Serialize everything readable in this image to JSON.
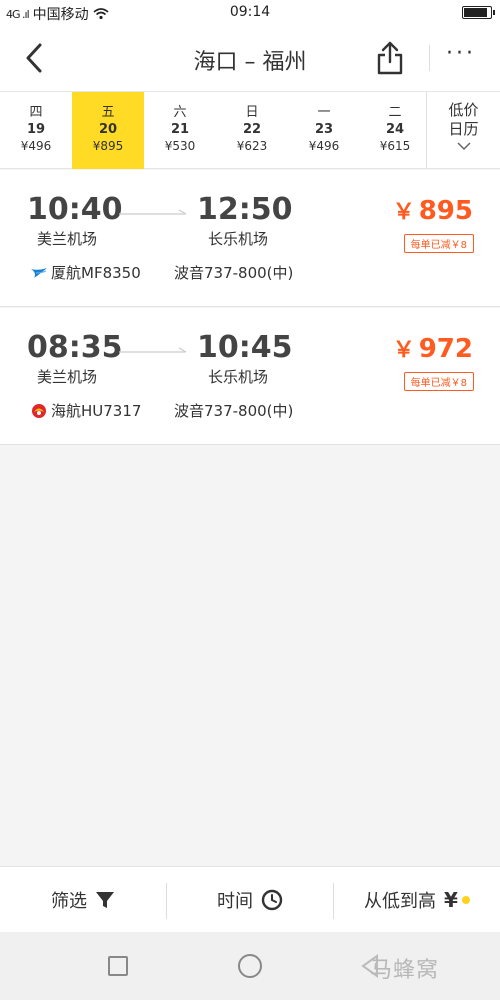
{
  "status_bar": {
    "signal": "4G .ıl",
    "carrier": "中国移动",
    "time": "09:14",
    "battery_level": 0.9
  },
  "header": {
    "title": "海口 – 福州",
    "back_icon": "chevron-left-icon",
    "share_icon": "share-icon",
    "more_icon": "more-icon",
    "more_label": "···"
  },
  "dates": [
    {
      "weekday": "四",
      "day": "19",
      "price": "¥496",
      "selected": false
    },
    {
      "weekday": "五",
      "day": "20",
      "price": "¥895",
      "selected": true
    },
    {
      "weekday": "六",
      "day": "21",
      "price": "¥530",
      "selected": false
    },
    {
      "weekday": "日",
      "day": "22",
      "price": "¥623",
      "selected": false
    },
    {
      "weekday": "一",
      "day": "23",
      "price": "¥496",
      "selected": false
    },
    {
      "weekday": "二",
      "day": "24",
      "price": "¥615",
      "selected": false
    }
  ],
  "calendar": {
    "line1": "低价",
    "line2": "日历",
    "icon": "chevron-down-icon"
  },
  "flights": [
    {
      "dep_time": "10:40",
      "arr_time": "12:50",
      "dep_airport": "美兰机场",
      "arr_airport": "长乐机场",
      "airline": "厦航MF8350",
      "aircraft": "波音737-800(中)",
      "currency": "￥",
      "price": "895",
      "discount": "每单已减￥8",
      "logo_icon": "xiamen-airlines-logo-icon"
    },
    {
      "dep_time": "08:35",
      "arr_time": "10:45",
      "dep_airport": "美兰机场",
      "arr_airport": "长乐机场",
      "airline": "海航HU7317",
      "aircraft": "波音737-800(中)",
      "currency": "￥",
      "price": "972",
      "discount": "每单已减￥8",
      "logo_icon": "hainan-airlines-logo-icon"
    }
  ],
  "bottom_bar": {
    "filter_label": "筛选",
    "filter_icon": "filter-icon",
    "time_label": "时间",
    "time_icon": "clock-icon",
    "sort_label": "从低到高",
    "sort_icon": "yen-icon",
    "sort_glyph": "¥"
  },
  "watermark": "马蜂窝",
  "colors": {
    "accent": "#ffdb26",
    "price": "#ff5a1f"
  }
}
